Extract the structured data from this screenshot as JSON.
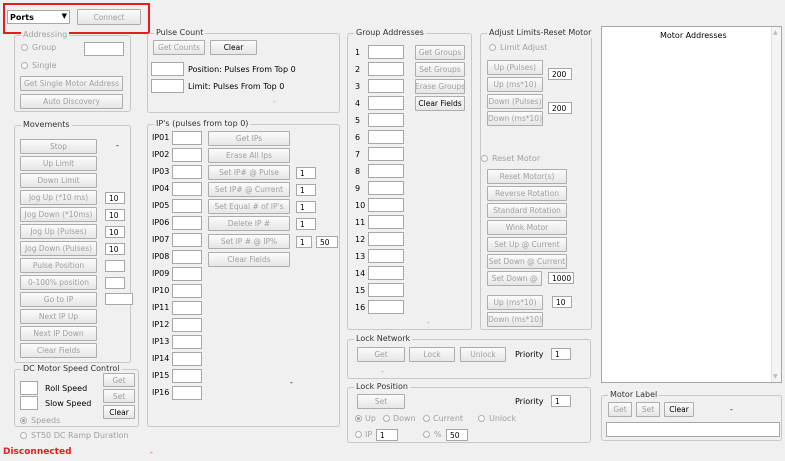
{
  "top": {
    "ports": "Ports",
    "connect": "Connect"
  },
  "addressing": {
    "legend": "Addressing",
    "group": "Group",
    "single": "Single",
    "get_single": "Get Single Motor Address",
    "auto": "Auto Discovery"
  },
  "pulse": {
    "legend": "Pulse Count",
    "get_counts": "Get Counts",
    "clear": "Clear",
    "position": "Position: Pulses From Top 0",
    "limit": "Limit: Pulses From Top 0"
  },
  "movements": {
    "legend": "Movements",
    "dash": "-",
    "stop": "Stop",
    "up_limit": "Up Limit",
    "down_limit": "Down Limit",
    "jog_up_ms": "Jog Up (*10 ms)",
    "jog_down_ms": "Jog Down (*10ms)",
    "jog_up_p": "Jog Up (Pulses)",
    "jog_down_p": "Jog Down (Pulses)",
    "pulse_pos": "Pulse Position",
    "pct_pos": "0-100% position",
    "go_ip": "Go to IP",
    "next_up": "Next IP Up",
    "next_down": "Next IP Down",
    "clear_fields": "Clear Fields",
    "v1": "10",
    "v2": "10",
    "v3": "10",
    "v4": "10"
  },
  "dc": {
    "legend": "DC Motor Speed Control",
    "get": "Get",
    "set": "Set",
    "roll": "Roll Speed",
    "slow": "Slow Speed",
    "clear": "Clear",
    "speeds": "Speeds",
    "st50": "ST50 DC Ramp Duration",
    "dash": "-"
  },
  "ips": {
    "legend": "IP's (pulses from top 0)",
    "labels": [
      "IP01",
      "IP02",
      "IP03",
      "IP04",
      "IP05",
      "IP06",
      "IP07",
      "IP08",
      "IP09",
      "IP10",
      "IP11",
      "IP12",
      "IP13",
      "IP14",
      "IP15",
      "IP16"
    ],
    "get_ips": "Get IPs",
    "erase_all": "Erase All Ips",
    "set_pulse": "Set IP# @ Pulse",
    "set_current": "Set IP# @ Current",
    "set_equal": "Set Equal # of IP's",
    "delete": "Delete IP #",
    "set_pct": "Set IP # @ IP%",
    "clear_fields": "Clear Fields",
    "n1": "1",
    "n2": "1",
    "n3": "1",
    "n4": "1",
    "n5": "1",
    "n6": "50",
    "dash": "-"
  },
  "group": {
    "legend": "Group Addresses",
    "labels": [
      "1",
      "2",
      "3",
      "4",
      "5",
      "6",
      "7",
      "8",
      "9",
      "10",
      "11",
      "12",
      "13",
      "14",
      "15",
      "16"
    ],
    "get": "Get Groups",
    "set": "Set Groups",
    "erase": "Erase Groups",
    "clear": "Clear Fields",
    "dash": "-"
  },
  "adjust": {
    "legend": "Adjust Limits-Reset Motor",
    "limit_adjust": "Limit Adjust",
    "up_pulses": "Up (Pulses)",
    "up_ms": "Up (ms*10)",
    "down_pulses": "Down (Pulses)",
    "down_ms": "Down (ms*10)",
    "v1": "200",
    "v2": "200",
    "reset": "Reset Motor",
    "reset_motor": "Reset Motor(s)",
    "reverse": "Reverse Rotation",
    "standard": "Standard Rotation",
    "wink": "Wink Motor",
    "set_up_cur": "Set Up @ Current",
    "set_down_cur": "Set Down @ Current",
    "set_down_at": "Set Down @",
    "v3": "1000",
    "up_ms2": "Up (ms*10)",
    "down_ms2": "Down (ms*10)",
    "v4": "10"
  },
  "motors": {
    "title": "Motor Addresses"
  },
  "lock": {
    "legend": "Lock Network",
    "get": "Get",
    "lock": "Lock",
    "unlock": "Unlock",
    "priority": "Priority",
    "pv": "1",
    "dash": "-"
  },
  "lockpos": {
    "legend": "Lock Position",
    "set": "Set",
    "priority": "Priority",
    "pv": "1",
    "up": "Up",
    "down": "Down",
    "current": "Current",
    "unlock": "Unlock",
    "ip": "IP",
    "ipv": "1",
    "pct": "%",
    "pctv": "50"
  },
  "label": {
    "legend": "Motor Label",
    "get": "Get",
    "set": "Set",
    "clear": "Clear",
    "dash": "-"
  },
  "status": {
    "text": "Disconnected",
    "dash": "-"
  },
  "colors": {
    "highlight": "#e02020",
    "status": "#e02020"
  }
}
